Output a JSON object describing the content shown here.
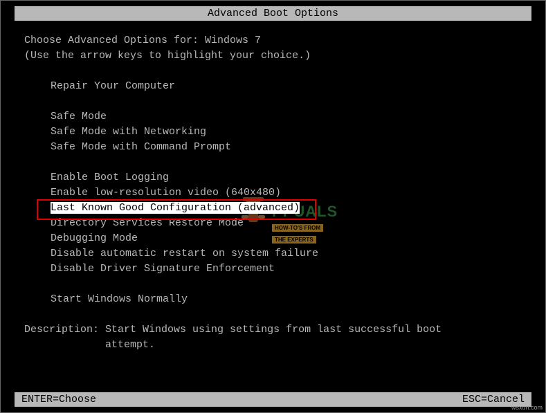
{
  "title": "Advanced Boot Options",
  "header": {
    "line1_prefix": "Choose Advanced Options for: ",
    "os_name": "Windows 7",
    "line2": "(Use the arrow keys to highlight your choice.)"
  },
  "options": {
    "group1": [
      "Repair Your Computer"
    ],
    "group2": [
      "Safe Mode",
      "Safe Mode with Networking",
      "Safe Mode with Command Prompt"
    ],
    "group3": [
      "Enable Boot Logging",
      "Enable low-resolution video (640x480)",
      "Last Known Good Configuration (advanced)",
      "Directory Services Restore Mode",
      "Debugging Mode",
      "Disable automatic restart on system failure",
      "Disable Driver Signature Enforcement"
    ],
    "group4": [
      "Start Windows Normally"
    ],
    "selected": "Last Known Good Configuration (advanced)"
  },
  "description": {
    "label": "Description: ",
    "text_line1": "Start Windows using settings from last successful boot",
    "text_line2": "attempt."
  },
  "footer": {
    "left": "ENTER=Choose",
    "right": "ESC=Cancel"
  },
  "watermark": {
    "brand": "PPUALS",
    "tag_l1": "HOW-TO'S FROM",
    "tag_l2": "THE EXPERTS",
    "corner": "wsxun.com"
  }
}
